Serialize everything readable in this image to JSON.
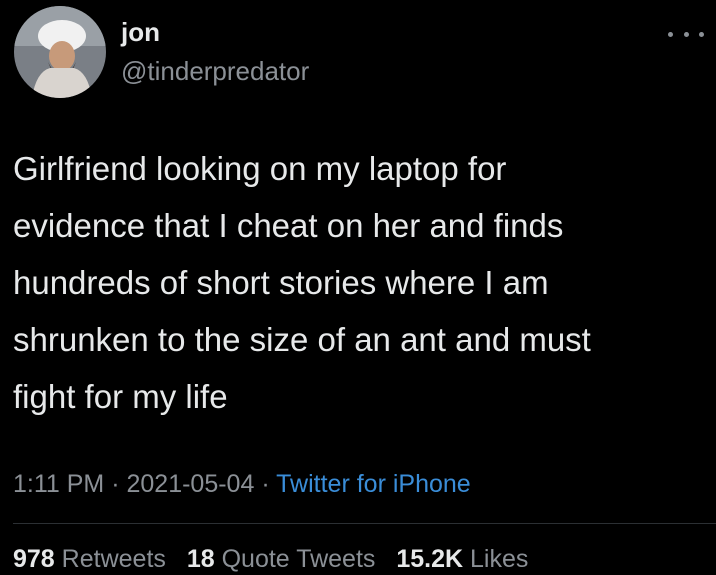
{
  "author": {
    "display_name": "jon",
    "handle": "@tinderpredator",
    "avatar_icon": "profile-photo-avatar"
  },
  "menu": {
    "icon": "more-options-icon"
  },
  "tweet": {
    "text": "Girlfriend looking on my laptop for\nevidence that I cheat on her and finds\nhundreds of short stories where I am\nshrunken to the size of an ant and must\nfight for my life",
    "time": "1:11 PM",
    "separator": "·",
    "date": "2021-05-04",
    "source": "Twitter for iPhone"
  },
  "stats": {
    "retweets_count": "978",
    "retweets_label": "Retweets",
    "quotes_count": "18",
    "quotes_label": "Quote Tweets",
    "likes_count": "15.2K",
    "likes_label": "Likes"
  },
  "colors": {
    "background": "#000000",
    "text": "#e7e9ea",
    "secondary": "#8b9096",
    "link": "#3a8dd8"
  }
}
